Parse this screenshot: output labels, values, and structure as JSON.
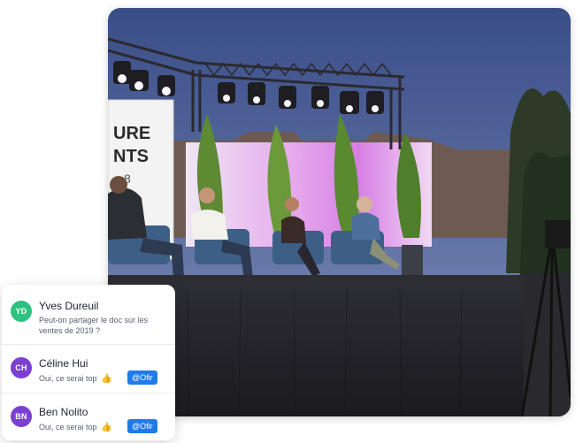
{
  "scene": {
    "banner_text": [
      "URE",
      "NTS",
      "8"
    ]
  },
  "colors": {
    "accent": "#1f7bea",
    "avatar_yd": "#2ec27e",
    "avatar_ch": "#7b3fd1",
    "avatar_bn": "#7b3fd1"
  },
  "chat": {
    "messages": [
      {
        "initials": "YD",
        "name": "Yves Dureuil",
        "text": "Peut-on partager le doc sur les ventes de 2019 ?"
      },
      {
        "initials": "CH",
        "name": "Céline Hui",
        "text": "Oui, ce serai top",
        "reaction": "👍",
        "mention": "@Ofir"
      },
      {
        "initials": "BN",
        "name": "Ben Nolito",
        "text": "Oui, ce serai top",
        "reaction": "👍",
        "mention": "@Ofir"
      }
    ]
  }
}
